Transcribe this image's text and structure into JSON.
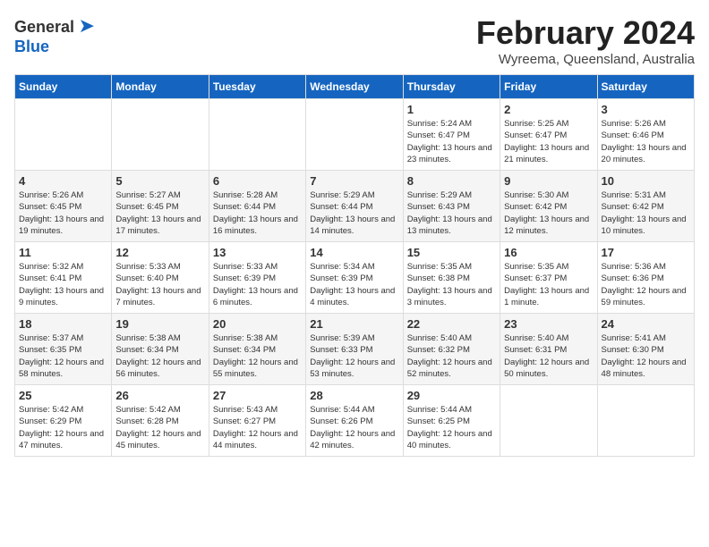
{
  "header": {
    "logo_general": "General",
    "logo_blue": "Blue",
    "title": "February 2024",
    "subtitle": "Wyreema, Queensland, Australia"
  },
  "weekdays": [
    "Sunday",
    "Monday",
    "Tuesday",
    "Wednesday",
    "Thursday",
    "Friday",
    "Saturday"
  ],
  "weeks": [
    [
      {
        "day": "",
        "empty": true
      },
      {
        "day": "",
        "empty": true
      },
      {
        "day": "",
        "empty": true
      },
      {
        "day": "",
        "empty": true
      },
      {
        "day": "1",
        "sunrise": "Sunrise: 5:24 AM",
        "sunset": "Sunset: 6:47 PM",
        "daylight": "Daylight: 13 hours and 23 minutes."
      },
      {
        "day": "2",
        "sunrise": "Sunrise: 5:25 AM",
        "sunset": "Sunset: 6:47 PM",
        "daylight": "Daylight: 13 hours and 21 minutes."
      },
      {
        "day": "3",
        "sunrise": "Sunrise: 5:26 AM",
        "sunset": "Sunset: 6:46 PM",
        "daylight": "Daylight: 13 hours and 20 minutes."
      }
    ],
    [
      {
        "day": "4",
        "sunrise": "Sunrise: 5:26 AM",
        "sunset": "Sunset: 6:45 PM",
        "daylight": "Daylight: 13 hours and 19 minutes."
      },
      {
        "day": "5",
        "sunrise": "Sunrise: 5:27 AM",
        "sunset": "Sunset: 6:45 PM",
        "daylight": "Daylight: 13 hours and 17 minutes."
      },
      {
        "day": "6",
        "sunrise": "Sunrise: 5:28 AM",
        "sunset": "Sunset: 6:44 PM",
        "daylight": "Daylight: 13 hours and 16 minutes."
      },
      {
        "day": "7",
        "sunrise": "Sunrise: 5:29 AM",
        "sunset": "Sunset: 6:44 PM",
        "daylight": "Daylight: 13 hours and 14 minutes."
      },
      {
        "day": "8",
        "sunrise": "Sunrise: 5:29 AM",
        "sunset": "Sunset: 6:43 PM",
        "daylight": "Daylight: 13 hours and 13 minutes."
      },
      {
        "day": "9",
        "sunrise": "Sunrise: 5:30 AM",
        "sunset": "Sunset: 6:42 PM",
        "daylight": "Daylight: 13 hours and 12 minutes."
      },
      {
        "day": "10",
        "sunrise": "Sunrise: 5:31 AM",
        "sunset": "Sunset: 6:42 PM",
        "daylight": "Daylight: 13 hours and 10 minutes."
      }
    ],
    [
      {
        "day": "11",
        "sunrise": "Sunrise: 5:32 AM",
        "sunset": "Sunset: 6:41 PM",
        "daylight": "Daylight: 13 hours and 9 minutes."
      },
      {
        "day": "12",
        "sunrise": "Sunrise: 5:33 AM",
        "sunset": "Sunset: 6:40 PM",
        "daylight": "Daylight: 13 hours and 7 minutes."
      },
      {
        "day": "13",
        "sunrise": "Sunrise: 5:33 AM",
        "sunset": "Sunset: 6:39 PM",
        "daylight": "Daylight: 13 hours and 6 minutes."
      },
      {
        "day": "14",
        "sunrise": "Sunrise: 5:34 AM",
        "sunset": "Sunset: 6:39 PM",
        "daylight": "Daylight: 13 hours and 4 minutes."
      },
      {
        "day": "15",
        "sunrise": "Sunrise: 5:35 AM",
        "sunset": "Sunset: 6:38 PM",
        "daylight": "Daylight: 13 hours and 3 minutes."
      },
      {
        "day": "16",
        "sunrise": "Sunrise: 5:35 AM",
        "sunset": "Sunset: 6:37 PM",
        "daylight": "Daylight: 13 hours and 1 minute."
      },
      {
        "day": "17",
        "sunrise": "Sunrise: 5:36 AM",
        "sunset": "Sunset: 6:36 PM",
        "daylight": "Daylight: 12 hours and 59 minutes."
      }
    ],
    [
      {
        "day": "18",
        "sunrise": "Sunrise: 5:37 AM",
        "sunset": "Sunset: 6:35 PM",
        "daylight": "Daylight: 12 hours and 58 minutes."
      },
      {
        "day": "19",
        "sunrise": "Sunrise: 5:38 AM",
        "sunset": "Sunset: 6:34 PM",
        "daylight": "Daylight: 12 hours and 56 minutes."
      },
      {
        "day": "20",
        "sunrise": "Sunrise: 5:38 AM",
        "sunset": "Sunset: 6:34 PM",
        "daylight": "Daylight: 12 hours and 55 minutes."
      },
      {
        "day": "21",
        "sunrise": "Sunrise: 5:39 AM",
        "sunset": "Sunset: 6:33 PM",
        "daylight": "Daylight: 12 hours and 53 minutes."
      },
      {
        "day": "22",
        "sunrise": "Sunrise: 5:40 AM",
        "sunset": "Sunset: 6:32 PM",
        "daylight": "Daylight: 12 hours and 52 minutes."
      },
      {
        "day": "23",
        "sunrise": "Sunrise: 5:40 AM",
        "sunset": "Sunset: 6:31 PM",
        "daylight": "Daylight: 12 hours and 50 minutes."
      },
      {
        "day": "24",
        "sunrise": "Sunrise: 5:41 AM",
        "sunset": "Sunset: 6:30 PM",
        "daylight": "Daylight: 12 hours and 48 minutes."
      }
    ],
    [
      {
        "day": "25",
        "sunrise": "Sunrise: 5:42 AM",
        "sunset": "Sunset: 6:29 PM",
        "daylight": "Daylight: 12 hours and 47 minutes."
      },
      {
        "day": "26",
        "sunrise": "Sunrise: 5:42 AM",
        "sunset": "Sunset: 6:28 PM",
        "daylight": "Daylight: 12 hours and 45 minutes."
      },
      {
        "day": "27",
        "sunrise": "Sunrise: 5:43 AM",
        "sunset": "Sunset: 6:27 PM",
        "daylight": "Daylight: 12 hours and 44 minutes."
      },
      {
        "day": "28",
        "sunrise": "Sunrise: 5:44 AM",
        "sunset": "Sunset: 6:26 PM",
        "daylight": "Daylight: 12 hours and 42 minutes."
      },
      {
        "day": "29",
        "sunrise": "Sunrise: 5:44 AM",
        "sunset": "Sunset: 6:25 PM",
        "daylight": "Daylight: 12 hours and 40 minutes."
      },
      {
        "day": "",
        "empty": true
      },
      {
        "day": "",
        "empty": true
      }
    ]
  ]
}
